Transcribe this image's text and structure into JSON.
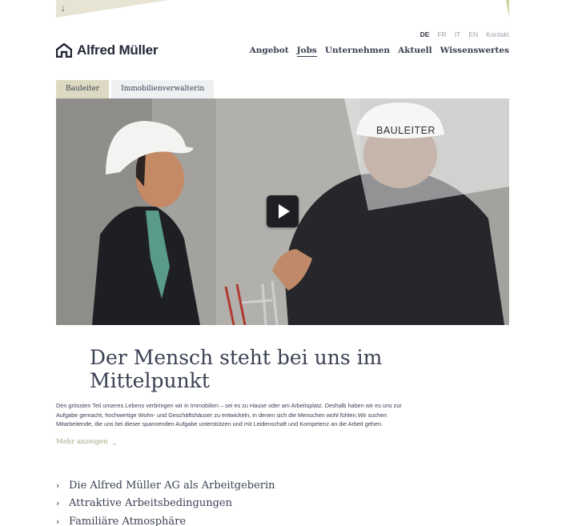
{
  "header": {
    "languages": [
      {
        "code": "DE",
        "active": true
      },
      {
        "code": "FR",
        "active": false
      },
      {
        "code": "IT",
        "active": false
      },
      {
        "code": "EN",
        "active": false
      }
    ],
    "contact_label": "Kontakt",
    "logo_text": "Alfred Müller",
    "logo_icon": "house-logo-icon",
    "scroll_icon": "arrow-down-icon",
    "scroll_glyph": "↓"
  },
  "nav": {
    "items": [
      {
        "label": "Angebot",
        "active": false
      },
      {
        "label": "Jobs",
        "active": true
      },
      {
        "label": "Unternehmen",
        "active": false
      },
      {
        "label": "Aktuell",
        "active": false
      },
      {
        "label": "Wissenswertes",
        "active": false
      }
    ]
  },
  "tabs": [
    {
      "label": "Bauleiter",
      "active": true
    },
    {
      "label": "Immobilienverwalterin",
      "active": false
    }
  ],
  "video": {
    "overlay_label": "BAULEITER",
    "play_icon": "play-icon"
  },
  "main": {
    "headline": "Der Mensch steht bei uns im Mittelpunkt",
    "intro": "Den grössten Teil unseres Lebens verbringen wir in Immobilien – sei es zu Hause oder am Arbeitsplatz. Deshalb haben wir es uns zur Aufgabe gemacht, hochwertige Wohn- und Geschäftshäuser zu entwickeln, in denen sich die Menschen wohl fühlen.Wir suchen Mitarbeitende, die uns bei dieser spannenden Aufgabe unterstützen und mit Leidenschaft und Kompetenz an die Arbeit gehen.",
    "more_label": "Mehr anzeigen",
    "more_glyph": "⌄"
  },
  "accordion": [
    {
      "label": "Die Alfred Müller AG als Arbeitgeberin"
    },
    {
      "label": "Attraktive Arbeitsbedingungen"
    },
    {
      "label": "Familiäre Atmosphäre"
    }
  ],
  "accordion_glyph": "›",
  "colors": {
    "accent": "#a8a27d",
    "tab_active": "#dcd8c2",
    "text": "#3a4152"
  }
}
